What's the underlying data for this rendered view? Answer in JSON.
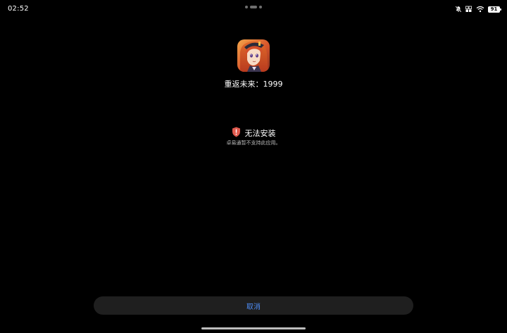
{
  "status_bar": {
    "time": "02:52",
    "battery_level": "91",
    "icons": [
      "mute-icon",
      "signal-icon",
      "wifi-icon",
      "battery-icon"
    ]
  },
  "app": {
    "name": "重返未来：1999",
    "icon": "app-icon"
  },
  "warning": {
    "icon": "shield-alert-icon",
    "title": "无法安装",
    "message": "卓易通暂不支持此应用。",
    "color": "#e05a4e"
  },
  "actions": {
    "cancel_label": "取消",
    "accent": "#4f8ef7"
  }
}
